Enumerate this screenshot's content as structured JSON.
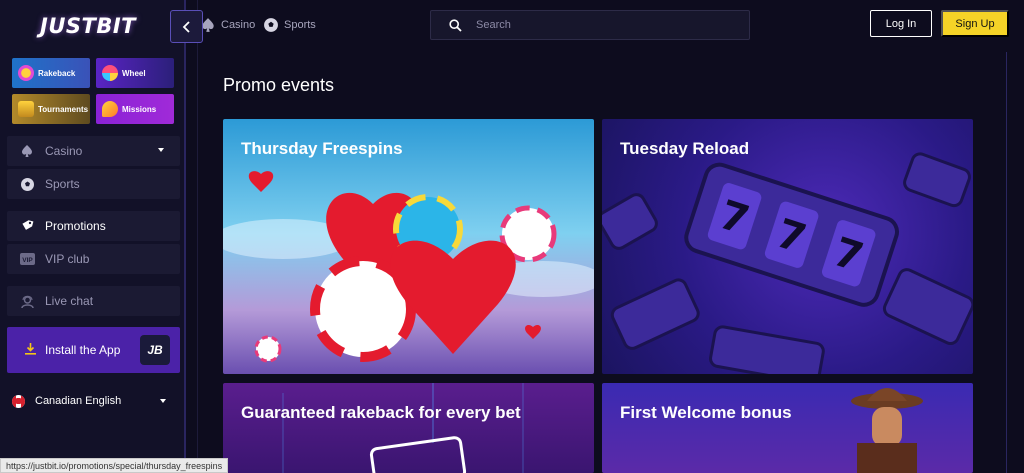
{
  "brand": {
    "logo_text": "JUSTBIT"
  },
  "header": {
    "nav_links": [
      {
        "label": "Casino",
        "icon": "spade-icon"
      },
      {
        "label": "Sports",
        "icon": "soccer-ball-icon"
      }
    ],
    "search": {
      "placeholder": "Search",
      "value": ""
    },
    "login_label": "Log In",
    "signup_label": "Sign Up",
    "accent_color": "#f5d327"
  },
  "sidebar": {
    "tiles": [
      {
        "label": "Rakeback",
        "icon": "coins-icon"
      },
      {
        "label": "Wheel",
        "icon": "wheel-icon"
      },
      {
        "label": "Tournaments",
        "icon": "trophy-icon"
      },
      {
        "label": "Missions",
        "icon": "rocket-icon"
      }
    ],
    "items": [
      {
        "label": "Casino",
        "icon": "spade-icon"
      },
      {
        "label": "Sports",
        "icon": "soccer-ball-icon"
      },
      {
        "label": "Promotions",
        "icon": "tag-icon"
      },
      {
        "label": "VIP club",
        "icon": "vip-icon"
      },
      {
        "label": "Live chat",
        "icon": "support-agent-icon"
      }
    ],
    "install_label": "Install the App",
    "install_badge": "JB",
    "language": "Canadian English"
  },
  "main": {
    "title": "Promo events",
    "cards": [
      {
        "title": "Thursday Freespins"
      },
      {
        "title": "Tuesday Reload"
      },
      {
        "title": "Guaranteed rakeback for every bet"
      },
      {
        "title": "First Welcome bonus"
      }
    ]
  },
  "status_url": "https://justbit.io/promotions/special/thursday_freespins"
}
